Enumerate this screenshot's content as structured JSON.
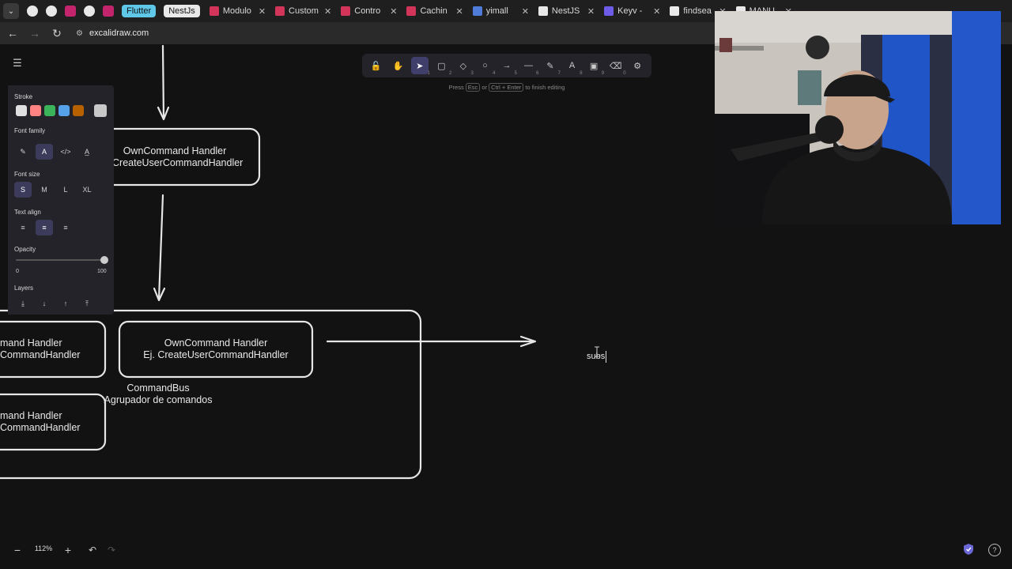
{
  "browser": {
    "tabs": [
      {
        "label": "Modulo",
        "color": "#d3355a"
      },
      {
        "label": "Custom",
        "color": "#d3355a"
      },
      {
        "label": "Contro",
        "color": "#d3355a"
      },
      {
        "label": "Cachin",
        "color": "#d3355a"
      },
      {
        "label": "yimall",
        "color": "#4f7bd9"
      },
      {
        "label": "NestJS",
        "color": "#e8e8e8"
      },
      {
        "label": "Keyv -",
        "color": "#6c5ce7"
      },
      {
        "label": "findsea",
        "color": "#e8e8e8"
      },
      {
        "label": "MANU",
        "color": "#e8e8e8"
      }
    ],
    "pills": [
      {
        "label": "Flutter",
        "color": "#5fc8e8"
      },
      {
        "label": "NestJs",
        "color": "#e9e9e9"
      }
    ],
    "url": "excalidraw.com"
  },
  "toolbar": {
    "hint_prefix": "Press",
    "hint_key1": "Esc",
    "hint_mid": "or",
    "hint_key2": "Ctrl + Enter",
    "hint_suffix": "to finish editing",
    "tools": [
      {
        "icon": "🔓",
        "key": ""
      },
      {
        "icon": "✋",
        "key": ""
      },
      {
        "icon": "➤",
        "key": "1"
      },
      {
        "icon": "▢",
        "key": "2"
      },
      {
        "icon": "◇",
        "key": "3"
      },
      {
        "icon": "○",
        "key": "4"
      },
      {
        "icon": "→",
        "key": "5"
      },
      {
        "icon": "—",
        "key": "6"
      },
      {
        "icon": "✎",
        "key": "7"
      },
      {
        "icon": "A",
        "key": "8"
      },
      {
        "icon": "▣",
        "key": "9"
      },
      {
        "icon": "⌫",
        "key": "0"
      },
      {
        "icon": "⚙",
        "key": ""
      }
    ]
  },
  "properties": {
    "stroke_label": "Stroke",
    "stroke_colors": [
      "#e0e0e0",
      "#ff8383",
      "#3bb35a",
      "#56a2e8",
      "#b76100"
    ],
    "stroke_current": "#c8c8c8",
    "font_family_label": "Font family",
    "font_family_options": [
      "✎",
      "A",
      "</>",
      "A̲"
    ],
    "font_size_label": "Font size",
    "font_sizes": [
      "S",
      "M",
      "L",
      "XL"
    ],
    "text_align_label": "Text align",
    "align_options": [
      "≡",
      "≡",
      "≡"
    ],
    "opacity_label": "Opacity",
    "opacity_min": "0",
    "opacity_max": "100",
    "opacity_value": 100,
    "layers_label": "Layers",
    "layer_options": [
      "⤓",
      "↓",
      "↑",
      "⤒"
    ]
  },
  "canvas": {
    "top_node_line1": "OwnCommand Handler",
    "top_node_line2": "CreateUserCommandHandler",
    "left_node1_line1": "mand Handler",
    "left_node1_line2": "CommandHandler",
    "mid_node_line1": "OwnCommand Handler",
    "mid_node_line2": "Ej. CreateUserCommandHandler",
    "bus_line1": "CommandBus",
    "bus_line2": "Agrupador de comandos",
    "left_node2_line1": "mand Handler",
    "left_node2_line2": "CommandHandler",
    "editing_text": "subs"
  },
  "footer": {
    "zoom": "112%",
    "zoom_minus": "−",
    "zoom_plus": "+",
    "undo": "↶",
    "redo": "↷"
  }
}
